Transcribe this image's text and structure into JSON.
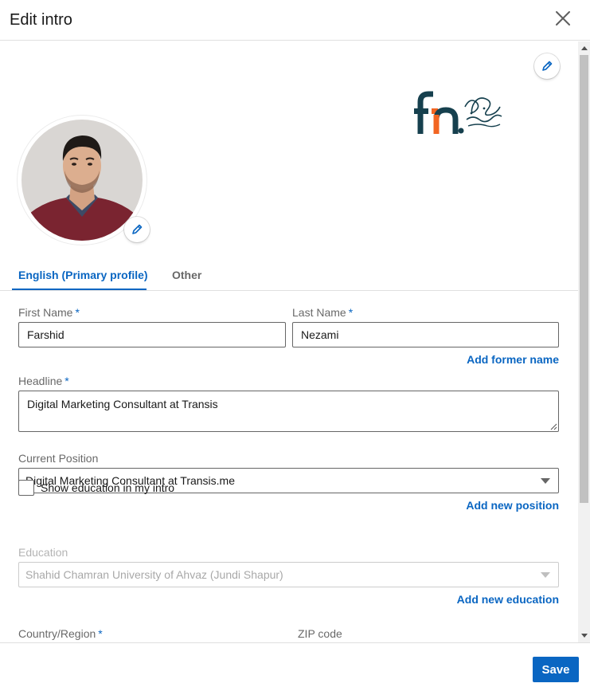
{
  "header": {
    "title": "Edit intro"
  },
  "tabs": [
    {
      "label": "English (Primary profile)",
      "active": true
    },
    {
      "label": "Other",
      "active": false
    }
  ],
  "form": {
    "first_name": {
      "label": "First Name",
      "required_mark": "*",
      "value": "Farshid"
    },
    "last_name": {
      "label": "Last Name",
      "required_mark": "*",
      "value": "Nezami"
    },
    "add_former_name": "Add former name",
    "headline": {
      "label": "Headline",
      "required_mark": "*",
      "value": "Digital Marketing Consultant at Transis"
    },
    "current_position": {
      "label": "Current Position",
      "value": "Digital Marketing Consultant at Transis.me"
    },
    "add_new_position": "Add new position",
    "show_education": {
      "label": "Show education in my intro",
      "checked": false
    },
    "education": {
      "label": "Education",
      "value": "Shahid Chamran University of Ahvaz (Jundi Shapur)",
      "disabled": true
    },
    "add_new_education": "Add new education",
    "country": {
      "label": "Country/Region",
      "required_mark": "*"
    },
    "zip": {
      "label": "ZIP code"
    }
  },
  "footer": {
    "save_label": "Save"
  },
  "icons": {
    "close": "close-icon",
    "edit_background": "pencil-icon",
    "edit_photo": "pencil-icon"
  },
  "colors": {
    "accent": "#0a66c2",
    "logo_dark": "#16404e",
    "logo_orange": "#f26522"
  }
}
